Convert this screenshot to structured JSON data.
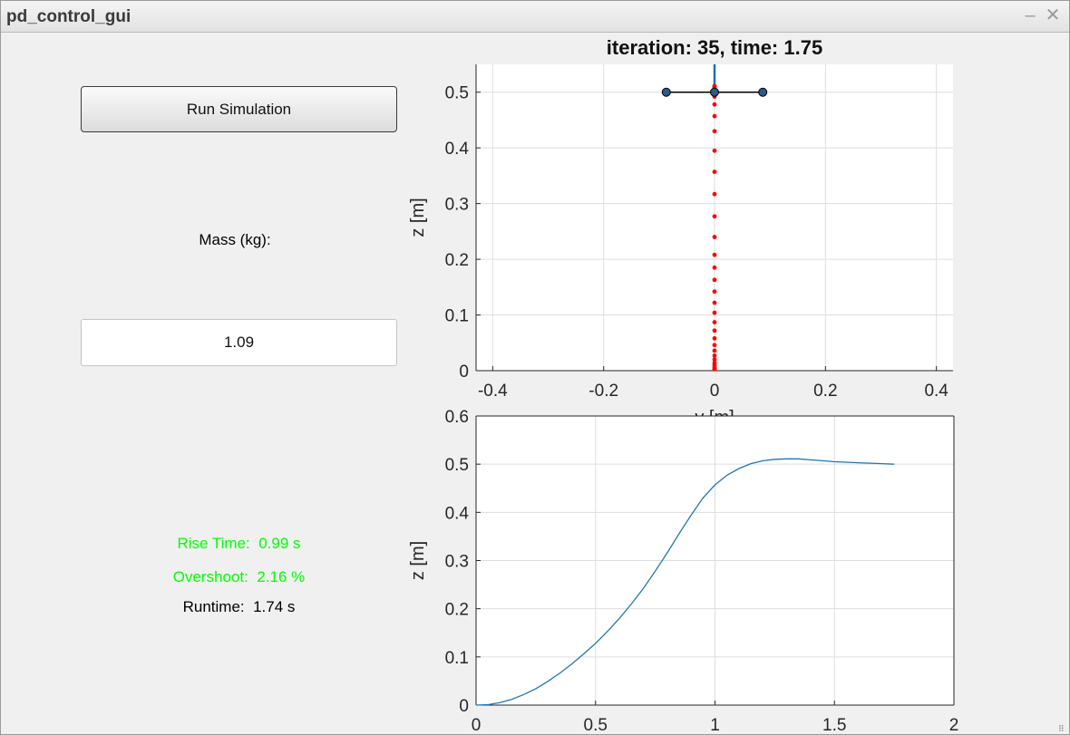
{
  "window": {
    "title": "pd_control_gui",
    "minimize_glyph": "–",
    "close_glyph": "✕"
  },
  "controls": {
    "run_label": "Run Simulation",
    "mass_label": "Mass (kg):",
    "mass_value": "1.09"
  },
  "metrics": {
    "rise_time": "Rise Time:  0.99 s",
    "overshoot": "Overshoot:  2.16 %",
    "runtime": "Runtime:  1.74 s",
    "pass_color": "#00ff00",
    "neutral_color": "#000000"
  },
  "icons": {
    "minimize": "minimize-icon",
    "close": "close-icon",
    "resize": "resize-grip-icon"
  },
  "chart_data": [
    {
      "type": "scatter",
      "title": "iteration: 35, time: 1.75",
      "xlabel": "y [m]",
      "ylabel": "z [m]",
      "xlim": [
        -0.43,
        0.43
      ],
      "ylim": [
        0,
        0.55
      ],
      "x_ticks": [
        -0.4,
        -0.2,
        0,
        0.2,
        0.4
      ],
      "x_tick_labels": [
        "-0.4",
        "-0.2",
        "0",
        "0.2",
        "0.4"
      ],
      "y_ticks": [
        0,
        0.1,
        0.2,
        0.3,
        0.4,
        0.5
      ],
      "y_tick_labels": [
        "0",
        "0.1",
        "0.2",
        "0.3",
        "0.4",
        "0.5"
      ],
      "grid": true,
      "trajectory": {
        "color": "#ff0000",
        "y": 0,
        "z": [
          0.0,
          0.001,
          0.002,
          0.004,
          0.006,
          0.01,
          0.014,
          0.02,
          0.027,
          0.036,
          0.046,
          0.058,
          0.072,
          0.087,
          0.104,
          0.122,
          0.142,
          0.163,
          0.185,
          0.208,
          0.24,
          0.277,
          0.317,
          0.357,
          0.395,
          0.43,
          0.457,
          0.478,
          0.492,
          0.501,
          0.507,
          0.51,
          0.511,
          0.51,
          0.509
        ]
      },
      "vehicle": {
        "color": "#000000",
        "marker_color": "#2c5a8a",
        "center": [
          0,
          0.5
        ],
        "arm_half_width": 0.087,
        "thrust_color": "#1f6fb2",
        "thrust_top": 0.55
      }
    },
    {
      "type": "line",
      "title": "",
      "xlabel": "",
      "ylabel": "z [m]",
      "xlim": [
        0,
        2
      ],
      "ylim": [
        0,
        0.6
      ],
      "x_ticks": [
        0,
        0.5,
        1,
        1.5,
        2
      ],
      "x_tick_labels": [
        "0",
        "0.5",
        "1",
        "1.5",
        "2"
      ],
      "y_ticks": [
        0,
        0.1,
        0.2,
        0.3,
        0.4,
        0.5,
        0.6
      ],
      "y_tick_labels": [
        "0",
        "0.1",
        "0.2",
        "0.3",
        "0.4",
        "0.5",
        "0.6"
      ],
      "grid": true,
      "series": [
        {
          "color": "#1f77b4",
          "x": [
            0,
            0.05,
            0.1,
            0.15,
            0.2,
            0.25,
            0.3,
            0.35,
            0.4,
            0.45,
            0.5,
            0.55,
            0.6,
            0.65,
            0.7,
            0.75,
            0.8,
            0.85,
            0.9,
            0.95,
            1.0,
            1.05,
            1.1,
            1.15,
            1.2,
            1.25,
            1.3,
            1.35,
            1.4,
            1.45,
            1.5,
            1.55,
            1.6,
            1.65,
            1.7,
            1.75
          ],
          "values": [
            0.0,
            0.001,
            0.005,
            0.012,
            0.022,
            0.034,
            0.049,
            0.066,
            0.085,
            0.106,
            0.128,
            0.153,
            0.18,
            0.21,
            0.242,
            0.278,
            0.316,
            0.356,
            0.394,
            0.43,
            0.457,
            0.477,
            0.491,
            0.501,
            0.507,
            0.51,
            0.511,
            0.511,
            0.509,
            0.507,
            0.505,
            0.504,
            0.503,
            0.502,
            0.501,
            0.5
          ]
        }
      ]
    }
  ]
}
